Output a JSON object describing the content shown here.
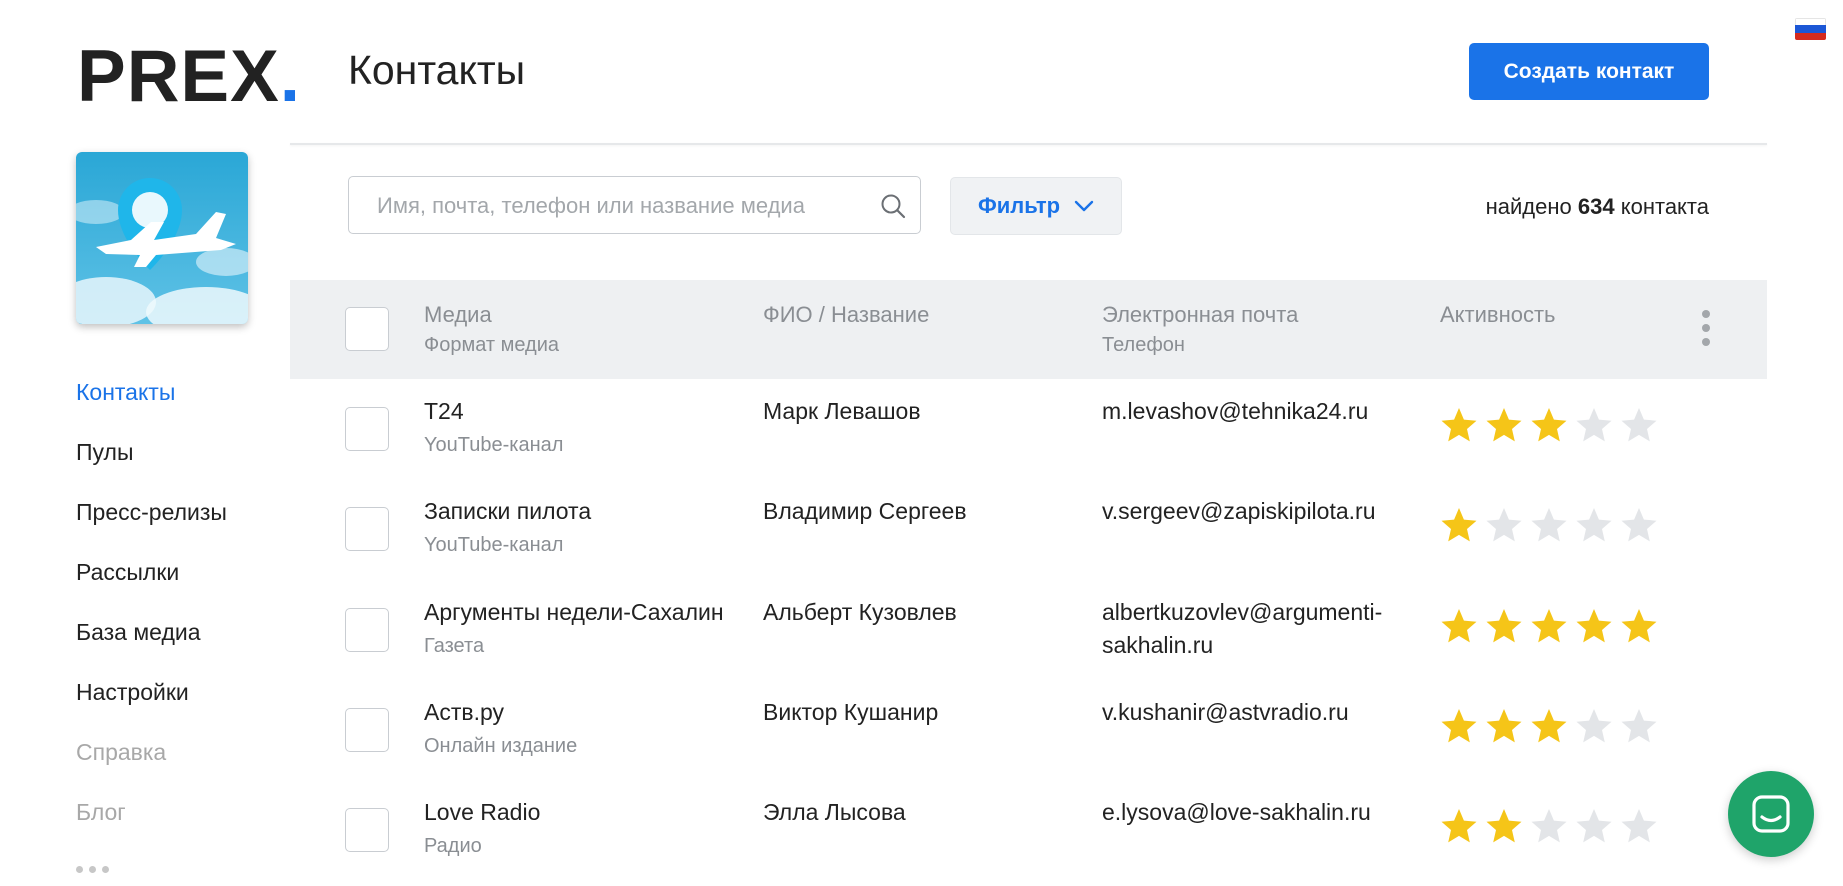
{
  "brand": {
    "name": "PREX",
    "dot": "."
  },
  "header": {
    "title": "Контакты",
    "create_button": "Создать контакт"
  },
  "sidebar": {
    "items": [
      {
        "label": "Контакты",
        "active": true
      },
      {
        "label": "Пулы"
      },
      {
        "label": "Пресс-релизы"
      },
      {
        "label": "Рассылки"
      },
      {
        "label": "База медиа"
      },
      {
        "label": "Настройки"
      },
      {
        "label": "Справка",
        "muted": true
      },
      {
        "label": "Блог",
        "muted": true
      }
    ]
  },
  "toolbar": {
    "search_placeholder": "Имя, почта, телефон или название медиа",
    "filter_label": "Фильтр",
    "found_prefix": "найдено",
    "found_count": "634",
    "found_suffix": "контакта"
  },
  "table": {
    "columns": [
      {
        "title": "Медиа",
        "subtitle": "Формат медиа"
      },
      {
        "title": "ФИО / Название",
        "subtitle": ""
      },
      {
        "title": "Электронная почта",
        "subtitle": "Телефон"
      },
      {
        "title": "Активность",
        "subtitle": ""
      }
    ],
    "rows": [
      {
        "media": "T24",
        "format": "YouTube-канал",
        "name": "Марк Левашов",
        "email": "m.levashov@tehnika24.ru",
        "rating": 3
      },
      {
        "media": "Записки пилота",
        "format": "YouTube-канал",
        "name": "Владимир Сергеев",
        "email": "v.sergeev@zapiskipilota.ru",
        "rating": 1
      },
      {
        "media": "Аргументы недели-Сахалин",
        "format": "Газета",
        "name": "Альберт Кузовлев",
        "email": "albertkuzovlev@argumenti-sakhalin.ru",
        "rating": 5
      },
      {
        "media": "Аств.ру",
        "format": "Онлайн издание",
        "name": "Виктор Кушанир",
        "email": "v.kushanir@astvradio.ru",
        "rating": 3
      },
      {
        "media": "Love Radio",
        "format": "Радио",
        "name": "Элла Лысова",
        "email": "e.lysova@love-sakhalin.ru",
        "rating": 2
      }
    ],
    "max_rating": 5
  },
  "colors": {
    "accent": "#1a73e8",
    "star_on": "#f5c518",
    "star_off": "#e3e5e8",
    "chat": "#1fa46a"
  },
  "icons": [
    "search-icon",
    "chevron-down-icon",
    "kebab-menu-icon",
    "star-icon",
    "chat-icon",
    "flag-icon"
  ]
}
